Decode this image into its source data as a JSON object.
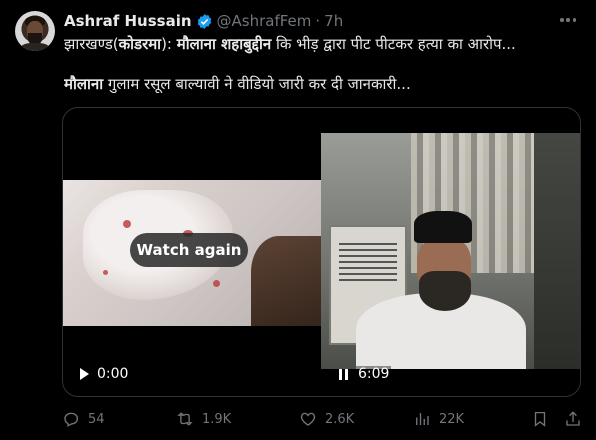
{
  "tweet": {
    "author_name": "Ashraf Hussain",
    "handle": "@AshrafFem",
    "separator": "·",
    "time": "7h",
    "line1": {
      "part1": "झारखण्ड(",
      "part2": "कोडरमा",
      "part3": "): ",
      "part4": "मौलाना शहाबुद्दीन",
      "part5": " कि भीड़ द्वारा पीट पीटकर हत्या का आरोप..."
    },
    "line2": {
      "part1": "मौलाना",
      "part2": " गुलाम रसूल बाल्यावी ने वीडियो जारी कर दी जानकारी..."
    }
  },
  "media": {
    "watch_again_label": "Watch again",
    "video1_time": "0:00",
    "video2_time": "6:09"
  },
  "actions": {
    "replies": "54",
    "reposts": "1.9K",
    "likes": "2.6K",
    "views": "22K"
  },
  "icons": {
    "verified": "verified-badge-icon",
    "more": "more-icon",
    "reply": "reply-icon",
    "repost": "repost-icon",
    "like": "heart-icon",
    "views": "views-icon",
    "bookmark": "bookmark-icon",
    "share": "share-icon"
  },
  "colors": {
    "background": "#000000",
    "text": "#e7e9ea",
    "muted": "#71767b",
    "verified": "#1d9bf0",
    "border": "#2f3336"
  }
}
